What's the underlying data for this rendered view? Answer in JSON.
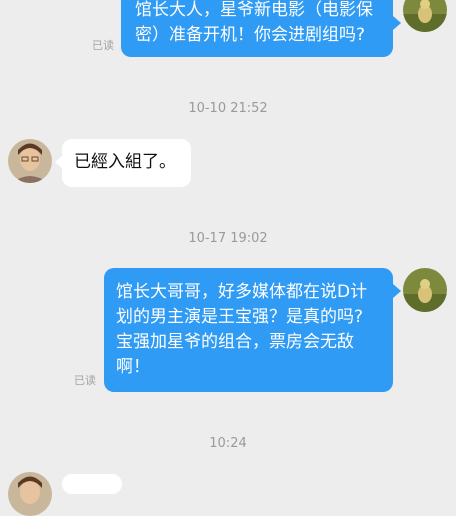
{
  "messages": [
    {
      "type": "outgoing",
      "lines": [
        "馆长大人，星爷新电影（电影保",
        "密）准备开机！你会进剧组吗?"
      ],
      "read": "已读"
    },
    {
      "type": "timestamp",
      "text": "10-10 21:52"
    },
    {
      "type": "incoming",
      "lines": [
        "已經入組了。"
      ]
    },
    {
      "type": "timestamp",
      "text": "10-17 19:02"
    },
    {
      "type": "outgoing",
      "lines": [
        "馆长大哥哥，好多媒体都在说D计",
        "划的男主演是王宝强？是真的吗?",
        "宝强加星爷的组合，票房会无敌",
        "啊！"
      ],
      "read": "已读"
    },
    {
      "type": "timestamp",
      "text": "10:24"
    }
  ],
  "colors": {
    "background": "#ededed",
    "outgoing_bubble": "#2f9bf4",
    "incoming_bubble": "#ffffff"
  }
}
